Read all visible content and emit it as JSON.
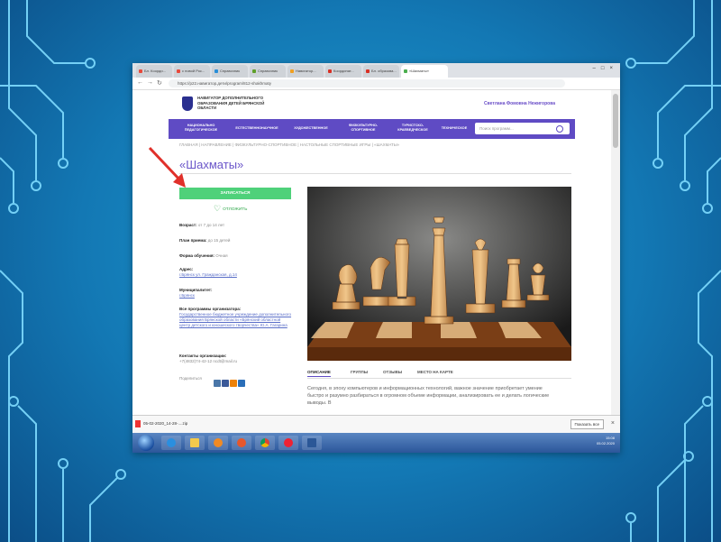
{
  "browser": {
    "tabs": [
      "Бл. Коорди...",
      "с новой Рос...",
      "Справочник",
      "Справочник",
      "Навигатор...",
      "Координат...",
      "Бл. образова...",
      "«Шахматы»"
    ],
    "tab_colors": [
      "#e84a3c",
      "#e84a3c",
      "#2a8fd8",
      "#5fa02a",
      "#f0a020",
      "#d93025",
      "#d93025",
      "#4caf50"
    ],
    "url": "https://p22.навигатор.дети/program/812-shakhmaty",
    "back": "←",
    "forward": "→",
    "reload": "↻",
    "window_buttons": "–□×"
  },
  "site": {
    "org_name": "НАВИГАТОР ДОПОЛНИТЕЛЬНОГО ОБРАЗОВАНИЯ ДЕТЕЙ БРЯНСКОЙ ОБЛАСТИ",
    "user": "Светлана Фомовна Нежигорова",
    "menu": [
      "НАЦИОНАЛЬНО ПЕДАГОГИЧЕСКОЕ",
      "ЕСТЕСТВЕННОНАУЧНОЕ",
      "ХУДОЖЕСТВЕННОЕ",
      "ФИЗКУЛЬТУРНО-СПОРТИВНОЕ",
      "ТУРИСТСКО-КРАЕВЕДЧЕСКОЕ",
      "ТЕХНИЧЕСКОЕ"
    ],
    "search_placeholder": "Поиск программ..."
  },
  "page": {
    "breadcrumb": "ГЛАВНАЯ | НАПРАВЛЕНИЕ | ФИЗКУЛЬТУРНО-СПОРТИВНОЕ | НАСТОЛЬНЫЕ СПОРТИВНЫЕ ИГРЫ | «ШАХМАТЫ»",
    "title": "«Шахматы»",
    "enroll": "ЗАПИСАТЬСЯ",
    "favorite": "ОТЛОЖИТЬ",
    "age_label": "Возраст:",
    "age_value": "от 7 до 14 лет",
    "plan_label": "План приема:",
    "plan_value": "до 15 детей",
    "form_label": "Форма обучения:",
    "form_value": "Очная",
    "address_label": "Адрес:",
    "address_value": "г.Брянск ул. Гражданская, д.14",
    "municipality_label": "Муниципалитет:",
    "municipality_value": "г.Брянск",
    "org_programs_label": "Все программы организатора:",
    "org_programs_value": "Государственное бюджетное учреждение дополнительного образования Брянской области «Брянский областной центр детского и юношеского творчества» Ю.А. Гагарина",
    "contacts_label": "Контакты организации:",
    "contacts_value": "+7(4832)74-42-12 ncdt@mail.ru",
    "share_label": "Поделиться",
    "tabs": [
      "ОПИСАНИЕ",
      "ГРУППЫ",
      "ОТЗЫВЫ",
      "МЕСТО НА КАРТЕ"
    ],
    "description": "Сегодня, в эпоху компьютеров и информационных технологий, важное значение приобретает умение быстро и разумно разбираться в огромном объеме информации, анализировать ее и делать логические выводы. В"
  },
  "downloads": {
    "file": "05-02-2020_14-28-....zip",
    "show_all": "Показать все",
    "close": "×"
  },
  "taskbar": {
    "time": "15:08",
    "date": "05.02.2020",
    "apps": [
      "ie-icon",
      "explorer-icon",
      "media-player-icon",
      "firefox-icon",
      "chrome-icon",
      "yandex-icon",
      "word-icon"
    ]
  },
  "colors": {
    "accent": "#5f4bc4",
    "enroll": "#4fd17a",
    "arrow": "#e0302a"
  }
}
